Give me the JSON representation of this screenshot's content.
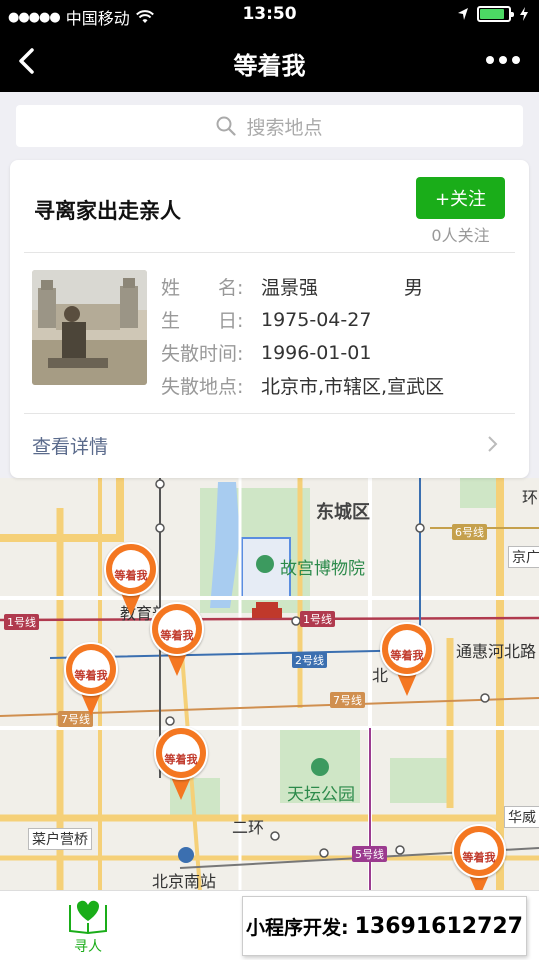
{
  "status_bar": {
    "carrier": "中国移动",
    "time": "13:50"
  },
  "nav": {
    "title": "等着我"
  },
  "search": {
    "placeholder": "搜索地点"
  },
  "card": {
    "title": "寻离家出走亲人",
    "follow_label": "+关注",
    "follow_count": "0人关注",
    "rows": [
      {
        "label": "姓　　名:",
        "value": "温景强",
        "extra": "男"
      },
      {
        "label": "生　　日:",
        "value": "1975-04-27"
      },
      {
        "label": "失散时间:",
        "value": "1996-01-01"
      },
      {
        "label": "失散地点:",
        "value": "北京市,市辖区,宣武区"
      }
    ],
    "detail_label": "查看详情"
  },
  "map": {
    "labels": {
      "dongcheng": "东城区",
      "palace": "故宫博物院",
      "temple": "天坛公园",
      "tonghui": "通惠河北路",
      "caihu": "菜户营桥",
      "south_station": "北京南站",
      "erhuan": "二环",
      "jiaoyu": "教育部",
      "bei": "北",
      "jing": "京广",
      "hua": "华威",
      "huan": "环"
    },
    "lines": {
      "l1": "1号线",
      "l1b": "1号线",
      "l2": "2号线",
      "l5": "5号线",
      "l6": "6号线",
      "l7": "7号线",
      "l7b": "7号线"
    },
    "pin_text": "等着我"
  },
  "tab": {
    "label": "寻人"
  },
  "contact": {
    "prefix": "小程序开发:",
    "phone": "13691612727"
  },
  "colors": {
    "nav_bg": "#000000",
    "accent_green": "#1aad19",
    "pin_orange": "#f47721"
  }
}
